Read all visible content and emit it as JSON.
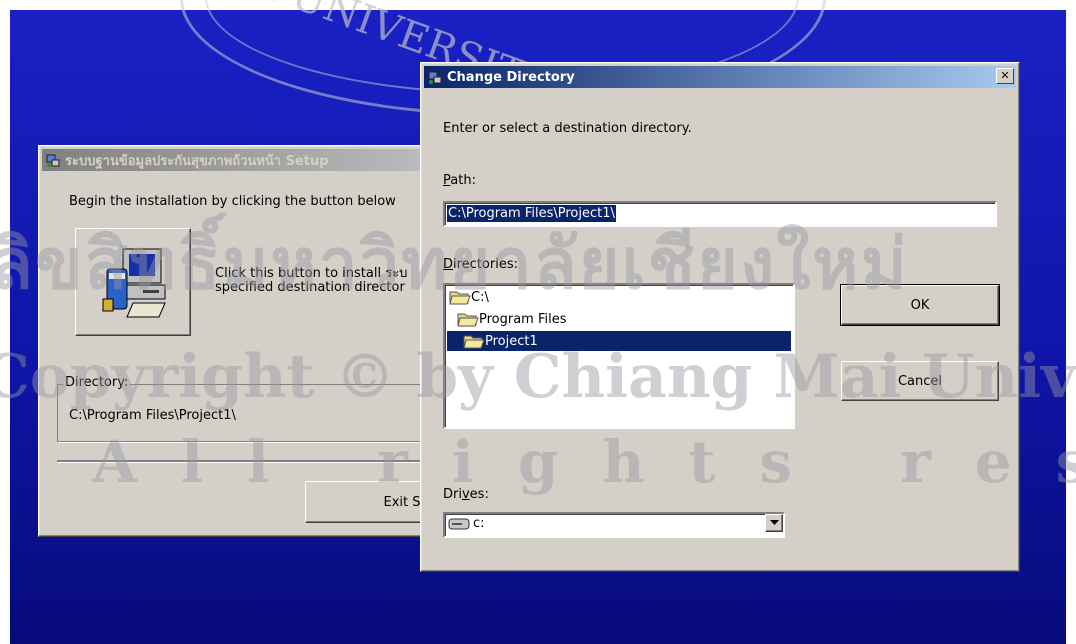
{
  "watermark": {
    "university_arc": "MAI UNIVERSITY",
    "line1": "ลิขสิทธิ์มหาวิทยาลัยเชียงใหม่",
    "line2": "Copyright © by Chiang Mai University",
    "line3": "All rights reserved"
  },
  "setup_window": {
    "title": "ระบบฐานข้อมูลประกันสุขภาพถ้วนหน้า Setup",
    "begin_text": "Begin the installation by clicking the button below",
    "install_text_line1": "Click this button to install ระบ",
    "install_text_line2": "specified destination director",
    "directory_label": "Directory:",
    "directory_value": "C:\\Program Files\\Project1\\",
    "exit_button": "Exit Se"
  },
  "change_directory": {
    "title": "Change Directory",
    "close_glyph": "✕",
    "prompt": "Enter or select a destination directory.",
    "path_label_hotkey": "P",
    "path_label_rest": "ath:",
    "path_value": "C:\\Program Files\\Project1\\",
    "directories_label_hotkey": "D",
    "directories_label_rest": "irectories:",
    "directories": [
      {
        "name": "C:\\",
        "selected": false
      },
      {
        "name": "Program Files",
        "selected": false
      },
      {
        "name": "Project1",
        "selected": true
      }
    ],
    "drives_label_pre": "Dri",
    "drives_label_hotkey": "v",
    "drives_label_post": "es:",
    "drive_value": "c:",
    "ok_button": "OK",
    "cancel_button": "Cancel"
  },
  "colors": {
    "desktop_top": "#1a21c4",
    "desktop_bottom": "#070b7a",
    "active_title": "#0a246a",
    "window_face": "#d4d0c8"
  }
}
